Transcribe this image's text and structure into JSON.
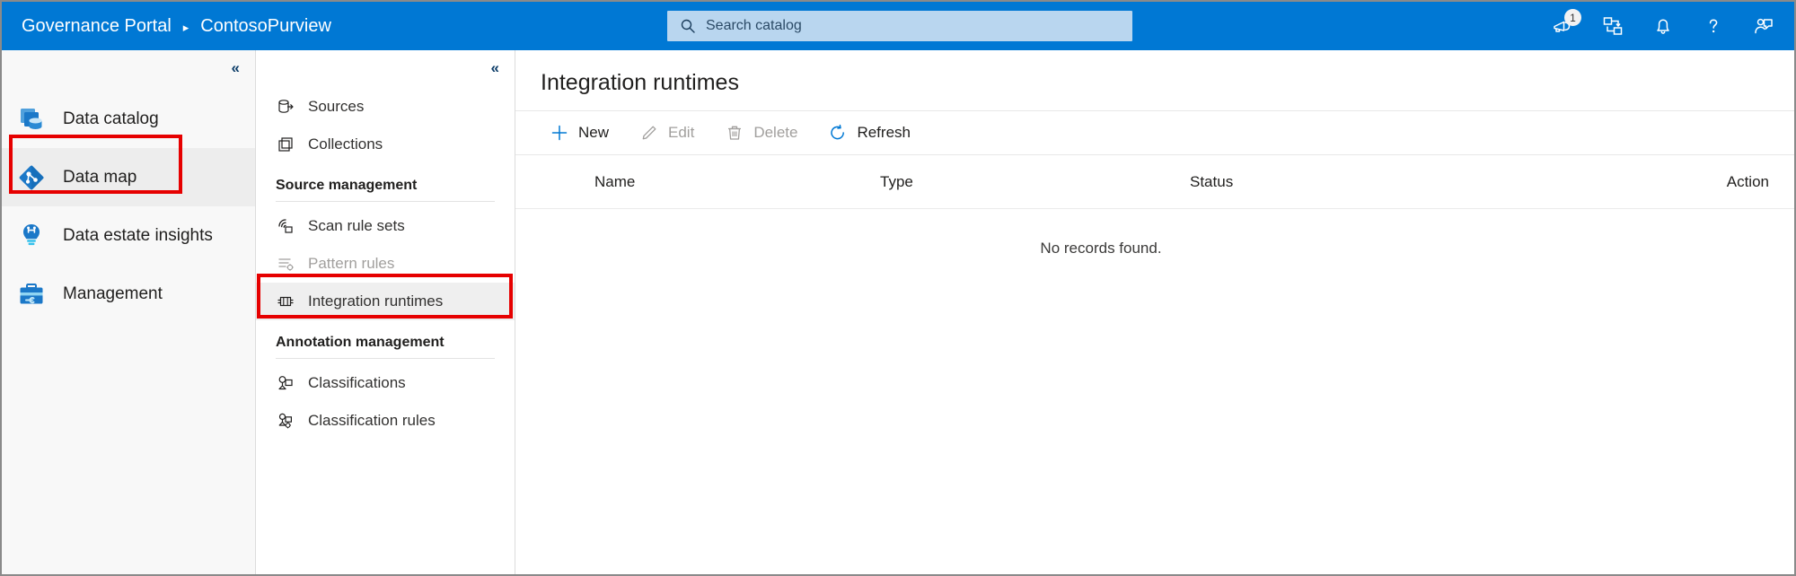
{
  "topbar": {
    "brand": "Governance Portal",
    "separator": "▸",
    "account": "ContosoPurview",
    "search": {
      "placeholder": "Search catalog",
      "value": "",
      "icon": "search-icon"
    },
    "icons": [
      {
        "name": "announcements-icon",
        "glyph": "megaphone",
        "badge": "1"
      },
      {
        "name": "data-map-grid-icon",
        "glyph": "grid-flow",
        "badge": ""
      },
      {
        "name": "notifications-bell-icon",
        "glyph": "bell",
        "badge": ""
      },
      {
        "name": "help-icon",
        "glyph": "question",
        "badge": ""
      },
      {
        "name": "feedback-icon",
        "glyph": "person-feedback",
        "badge": ""
      }
    ],
    "accent": "#0078d4",
    "search_bg": "#b9d6ef"
  },
  "nav_primary": {
    "collapse_label": "«",
    "items": [
      {
        "label": "Data catalog",
        "icon": "data-catalog-icon",
        "selected": false
      },
      {
        "label": "Data map",
        "icon": "data-map-icon",
        "selected": true
      },
      {
        "label": "Data estate insights",
        "icon": "data-estate-insights-icon",
        "selected": false
      },
      {
        "label": "Management",
        "icon": "management-icon",
        "selected": false
      }
    ]
  },
  "nav_secondary": {
    "collapse_label": "«",
    "items": [
      {
        "type": "item",
        "label": "Sources",
        "icon": "sources-icon",
        "selected": false,
        "disabled": false
      },
      {
        "type": "item",
        "label": "Collections",
        "icon": "collections-icon",
        "selected": false,
        "disabled": false
      },
      {
        "type": "group",
        "label": "Source management"
      },
      {
        "type": "item",
        "label": "Scan rule sets",
        "icon": "scan-rule-sets-icon",
        "selected": false,
        "disabled": false
      },
      {
        "type": "item",
        "label": "Pattern rules",
        "icon": "pattern-rules-icon",
        "selected": false,
        "disabled": true
      },
      {
        "type": "item",
        "label": "Integration runtimes",
        "icon": "integration-runtimes-icon",
        "selected": true,
        "disabled": false
      },
      {
        "type": "group",
        "label": "Annotation management"
      },
      {
        "type": "item",
        "label": "Classifications",
        "icon": "classifications-icon",
        "selected": false,
        "disabled": false
      },
      {
        "type": "item",
        "label": "Classification rules",
        "icon": "classification-rules-icon",
        "selected": false,
        "disabled": false
      }
    ]
  },
  "main": {
    "title": "Integration runtimes",
    "toolbar": [
      {
        "label": "New",
        "icon": "add-icon",
        "disabled": false
      },
      {
        "label": "Edit",
        "icon": "edit-icon",
        "disabled": true
      },
      {
        "label": "Delete",
        "icon": "delete-icon",
        "disabled": true
      },
      {
        "label": "Refresh",
        "icon": "refresh-icon",
        "disabled": false
      }
    ],
    "table": {
      "columns": [
        "Name",
        "Type",
        "Status",
        "Action"
      ],
      "rows": [],
      "empty_message": "No records found."
    }
  },
  "annotations": {
    "color": "#e60000",
    "boxes": [
      "data-map-nav-item",
      "integration-runtimes-nav-item"
    ]
  }
}
